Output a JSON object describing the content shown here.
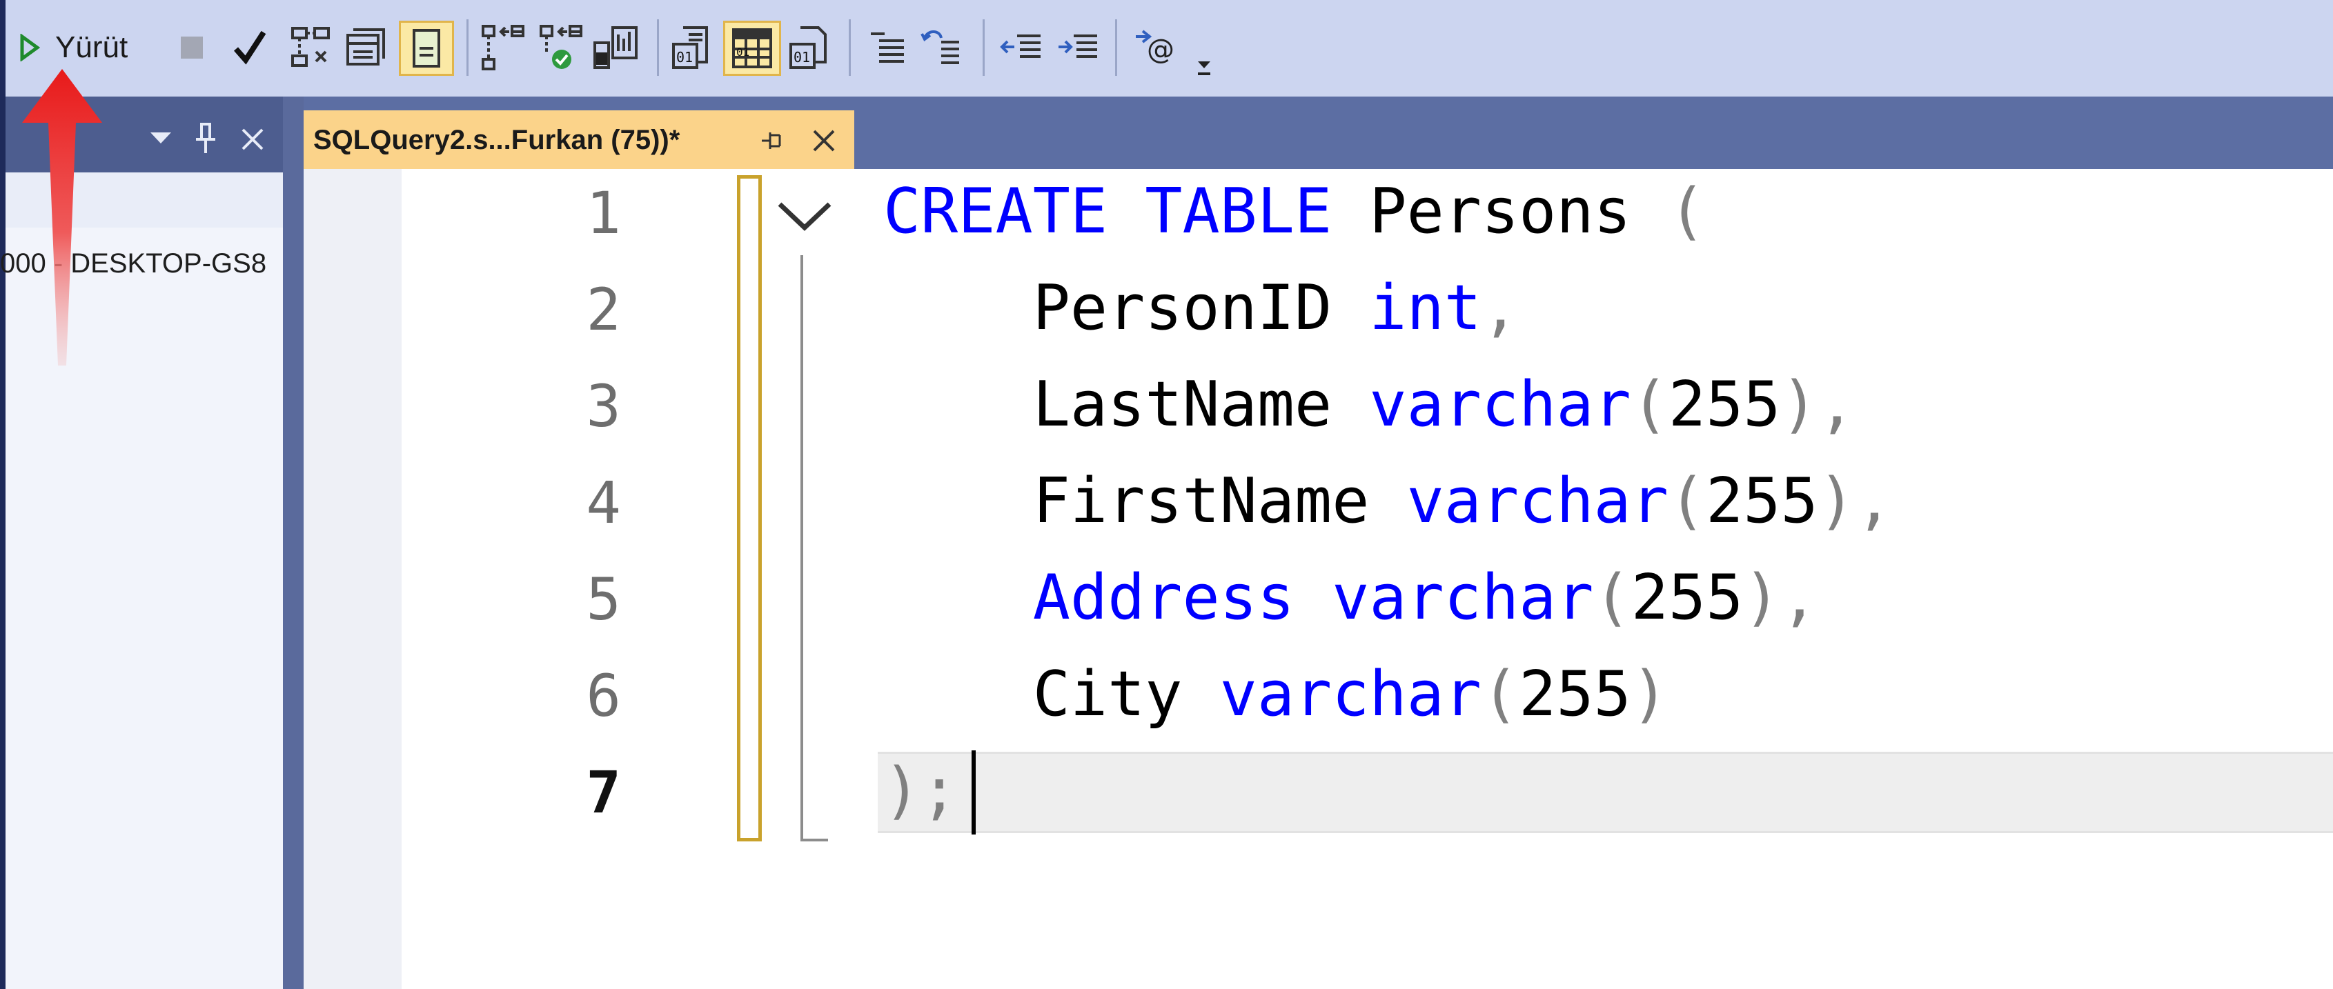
{
  "toolbar": {
    "run_label": "Yürüt",
    "buttons": [
      "execute-icon",
      "stop-icon",
      "parse-checkmark-icon",
      "display-estimated-plan-icon",
      "query-options-icon",
      "intellisense-toggle-icon",
      "include-actual-plan-icon",
      "live-query-stats-icon",
      "client-statistics-icon",
      "results-to-text-icon",
      "results-to-grid-icon",
      "results-to-file-icon",
      "comment-lines-icon",
      "uncomment-lines-icon",
      "decrease-indent-icon",
      "increase-indent-icon",
      "specify-template-values-icon",
      "toolbar-overflow-icon"
    ]
  },
  "left_panel": {
    "server_node": "000 - DESKTOP-GS8"
  },
  "editor": {
    "tab_title": "SQLQuery2.s...Furkan (75))*",
    "line_numbers": [
      "1",
      "2",
      "3",
      "4",
      "5",
      "6",
      "7"
    ],
    "lines": [
      [
        {
          "t": "CREATE",
          "c": "kw"
        },
        {
          "t": " ",
          "c": "id"
        },
        {
          "t": "TABLE",
          "c": "kw"
        },
        {
          "t": " Persons ",
          "c": "id"
        },
        {
          "t": "(",
          "c": "pn"
        }
      ],
      [
        {
          "t": "    PersonID ",
          "c": "id"
        },
        {
          "t": "int",
          "c": "kw"
        },
        {
          "t": ",",
          "c": "pn"
        }
      ],
      [
        {
          "t": "    LastName ",
          "c": "id"
        },
        {
          "t": "varchar",
          "c": "kw"
        },
        {
          "t": "(",
          "c": "pn"
        },
        {
          "t": "255",
          "c": "id"
        },
        {
          "t": "),",
          "c": "pn"
        }
      ],
      [
        {
          "t": "    FirstName ",
          "c": "id"
        },
        {
          "t": "varchar",
          "c": "kw"
        },
        {
          "t": "(",
          "c": "pn"
        },
        {
          "t": "255",
          "c": "id"
        },
        {
          "t": "),",
          "c": "pn"
        }
      ],
      [
        {
          "t": "    ",
          "c": "id"
        },
        {
          "t": "Address",
          "c": "kw"
        },
        {
          "t": " ",
          "c": "id"
        },
        {
          "t": "varchar",
          "c": "kw"
        },
        {
          "t": "(",
          "c": "pn"
        },
        {
          "t": "255",
          "c": "id"
        },
        {
          "t": "),",
          "c": "pn"
        }
      ],
      [
        {
          "t": "    City ",
          "c": "id"
        },
        {
          "t": "varchar",
          "c": "kw"
        },
        {
          "t": "(",
          "c": "pn"
        },
        {
          "t": "255",
          "c": "id"
        },
        {
          "t": ")",
          "c": "pn"
        }
      ],
      [
        {
          "t": ");",
          "c": "pn"
        }
      ]
    ]
  },
  "colors": {
    "keyword": "#0000ff",
    "identifier": "#000000",
    "punctuation": "#808080",
    "tab_active": "#fbd38a",
    "toolbar": "#ccd5f0",
    "annotation_arrow": "#e81a1a"
  }
}
